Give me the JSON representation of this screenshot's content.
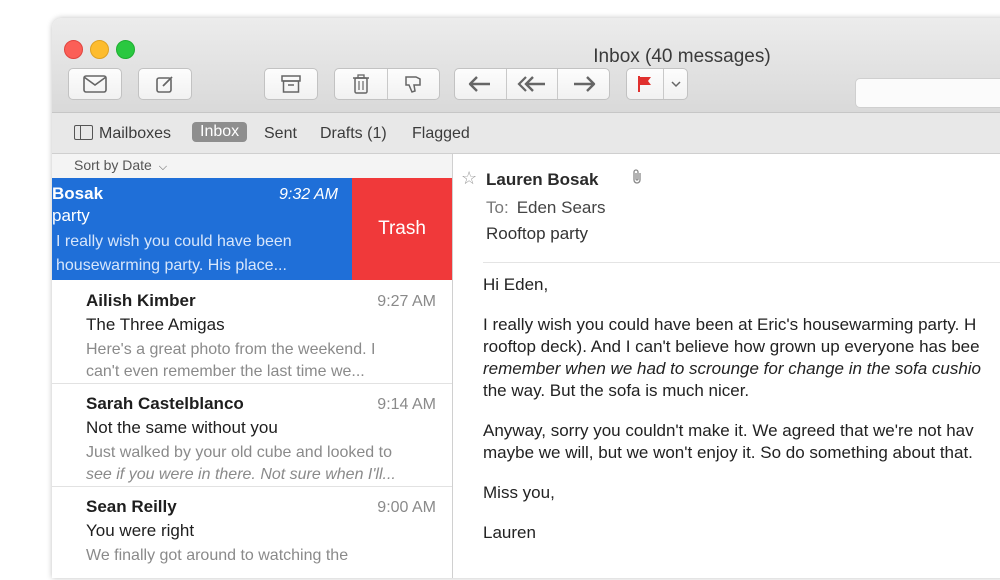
{
  "window": {
    "title": "Inbox (40 messages)"
  },
  "toolbar": {
    "get_mail_icon": "envelope-icon",
    "compose_icon": "compose-icon",
    "archive_icon": "archive-icon",
    "delete_icon": "trash-icon",
    "junk_icon": "thumbs-down-icon",
    "reply_icon": "reply-icon",
    "reply_all_icon": "reply-all-icon",
    "forward_icon": "forward-icon",
    "flag_color": "#e0302e"
  },
  "favorites": {
    "mailboxes": "Mailboxes",
    "inbox": "Inbox",
    "sent": "Sent",
    "drafts": "Drafts (1)",
    "flagged": "Flagged"
  },
  "list": {
    "sort_label": "Sort by Date",
    "swipe_action": "Trash",
    "selected": {
      "from": "Bosak",
      "time": "9:32 AM",
      "subject": "party",
      "preview_1": "I really wish you could have been",
      "preview_2": "housewarming party. His place..."
    },
    "messages": [
      {
        "from": "Ailish Kimber",
        "time": "9:27 AM",
        "subject": "The Three Amigas",
        "preview_1": "Here's a great photo from the weekend. I",
        "preview_2": "can't even remember the last time we..."
      },
      {
        "from": "Sarah Castelblanco",
        "time": "9:14 AM",
        "subject": "Not the same without you",
        "preview_1": "Just walked by your old cube and looked to",
        "preview_2": "see if you were in there. Not sure when I'll..."
      },
      {
        "from": "Sean Reilly",
        "time": "9:00 AM",
        "subject": "You were right",
        "preview_1": "We finally got around to watching the",
        "preview_2": ""
      }
    ]
  },
  "message": {
    "from": "Lauren Bosak",
    "to_label": "To:",
    "to": "Eden Sears",
    "subject": "Rooftop party",
    "greeting": "Hi Eden,",
    "p1_line1": "I really wish you could have been at Eric's housewarming party. H",
    "p1_line2": "rooftop deck). And I can't believe how grown up everyone has bee",
    "p1_line3": "remember when we had to scrounge for change in the sofa cushio",
    "p1_line4": "the way. But the sofa is much nicer.",
    "p2_line1": "Anyway, sorry you couldn't make it. We agreed that we're not hav",
    "p2_line2": "maybe we will, but we won't enjoy it. So do something about that.",
    "closing": "Miss you,",
    "signature": "Lauren"
  }
}
